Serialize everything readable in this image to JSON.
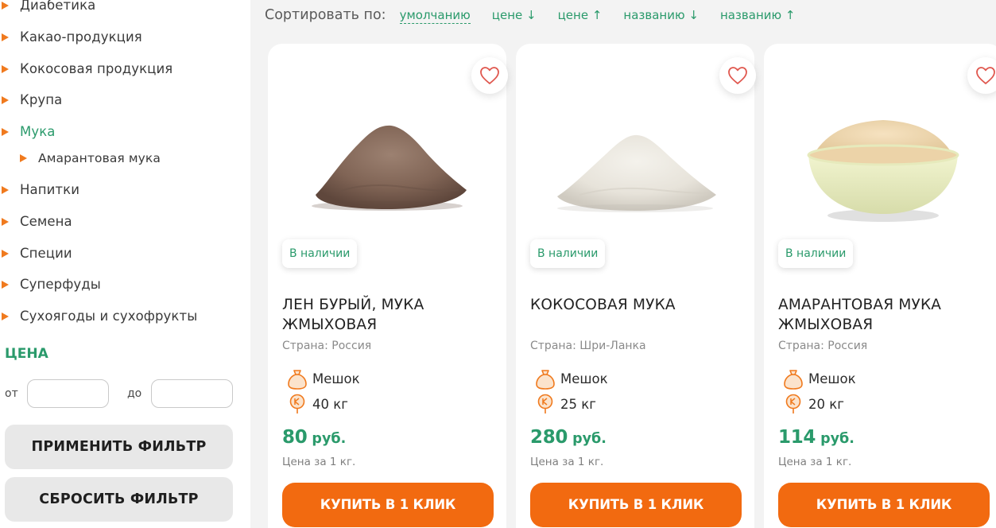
{
  "sidebar": {
    "categories": [
      {
        "label": "Диабетика"
      },
      {
        "label": "Какао-продукция"
      },
      {
        "label": "Кокосовая продукция"
      },
      {
        "label": "Крупа"
      },
      {
        "label": "Мука",
        "active": true
      },
      {
        "label": "Амарантовая мука",
        "sub": true
      },
      {
        "label": "Напитки"
      },
      {
        "label": "Семена"
      },
      {
        "label": "Специи"
      },
      {
        "label": "Суперфуды"
      },
      {
        "label": "Сухоягоды и сухофрукты"
      }
    ],
    "price_filter": {
      "title": "ЦЕНА",
      "from_label": "от",
      "to_label": "до",
      "from_value": "",
      "to_value": "",
      "apply_label": "ПРИМЕНИТЬ ФИЛЬТР",
      "reset_label": "СБРОСИТЬ ФИЛЬТР"
    }
  },
  "sort": {
    "label": "Сортировать по:",
    "options": [
      "умолчанию",
      "цене ↓",
      "цене ↑",
      "названию ↓",
      "названию ↑"
    ],
    "current": "умолчанию"
  },
  "products": [
    {
      "stock": "В наличии",
      "name": "ЛЕН БУРЫЙ, МУКА ЖМЫХОВАЯ",
      "country": "Страна: Россия",
      "package": "Мешок",
      "weight": "40 кг",
      "price": "80",
      "currency": "руб.",
      "unit_note": "Цена за 1 кг.",
      "buy_label": "КУПИТЬ В 1 КЛИК",
      "image": "brown-flour-pile"
    },
    {
      "stock": "В наличии",
      "name": "КОКОСОВАЯ МУКА",
      "country": "Страна: Шри-Ланка",
      "package": "Мешок",
      "weight": "25 кг",
      "price": "280",
      "currency": "руб.",
      "unit_note": "Цена за 1 кг.",
      "buy_label": "КУПИТЬ В 1 КЛИК",
      "image": "white-flour-pile"
    },
    {
      "stock": "В наличии",
      "name": "АМАРАНТОВАЯ МУКА ЖМЫХОВАЯ",
      "country": "Страна: Россия",
      "package": "Мешок",
      "weight": "20 кг",
      "price": "114",
      "currency": "руб.",
      "unit_note": "Цена за 1 кг.",
      "buy_label": "КУПИТЬ В 1 КЛИК",
      "image": "flour-in-bowl"
    }
  ],
  "colors": {
    "accent_green": "#2a9a6b",
    "accent_orange": "#f26a10",
    "bullet_orange": "#f07a1e",
    "heart_red": "#e0584f"
  },
  "icons": [
    "bullet-triangle-icon",
    "heart-icon",
    "sack-icon",
    "weight-tag-icon"
  ]
}
